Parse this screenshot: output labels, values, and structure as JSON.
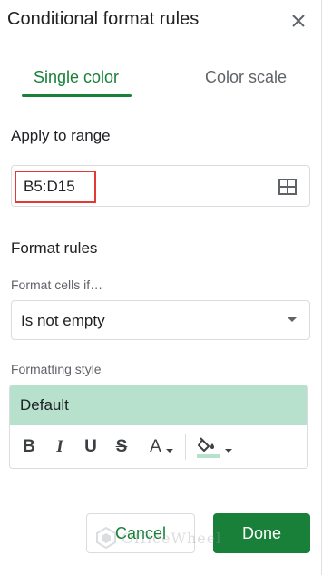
{
  "header": {
    "title": "Conditional format rules",
    "close_icon": "close-icon"
  },
  "tabs": [
    {
      "label": "Single color",
      "active": true
    },
    {
      "label": "Color scale",
      "active": false
    }
  ],
  "apply_to_range": {
    "label": "Apply to range",
    "value": "B5:D15",
    "icon": "grid-select-icon"
  },
  "format_rules": {
    "label": "Format rules",
    "condition_label": "Format cells if…",
    "condition_value": "Is not empty"
  },
  "formatting_style": {
    "label": "Formatting style",
    "preview_label": "Default",
    "preview_fill_color": "#b7e1cd",
    "toolbar": {
      "bold": "B",
      "italic": "I",
      "underline": "U",
      "strikethrough": "S",
      "text_color": "A"
    }
  },
  "buttons": {
    "cancel": "Cancel",
    "done": "Done"
  },
  "colors": {
    "accent": "#188038",
    "highlight_border": "#e53935"
  },
  "watermark": {
    "text": "OfficeWheel"
  }
}
